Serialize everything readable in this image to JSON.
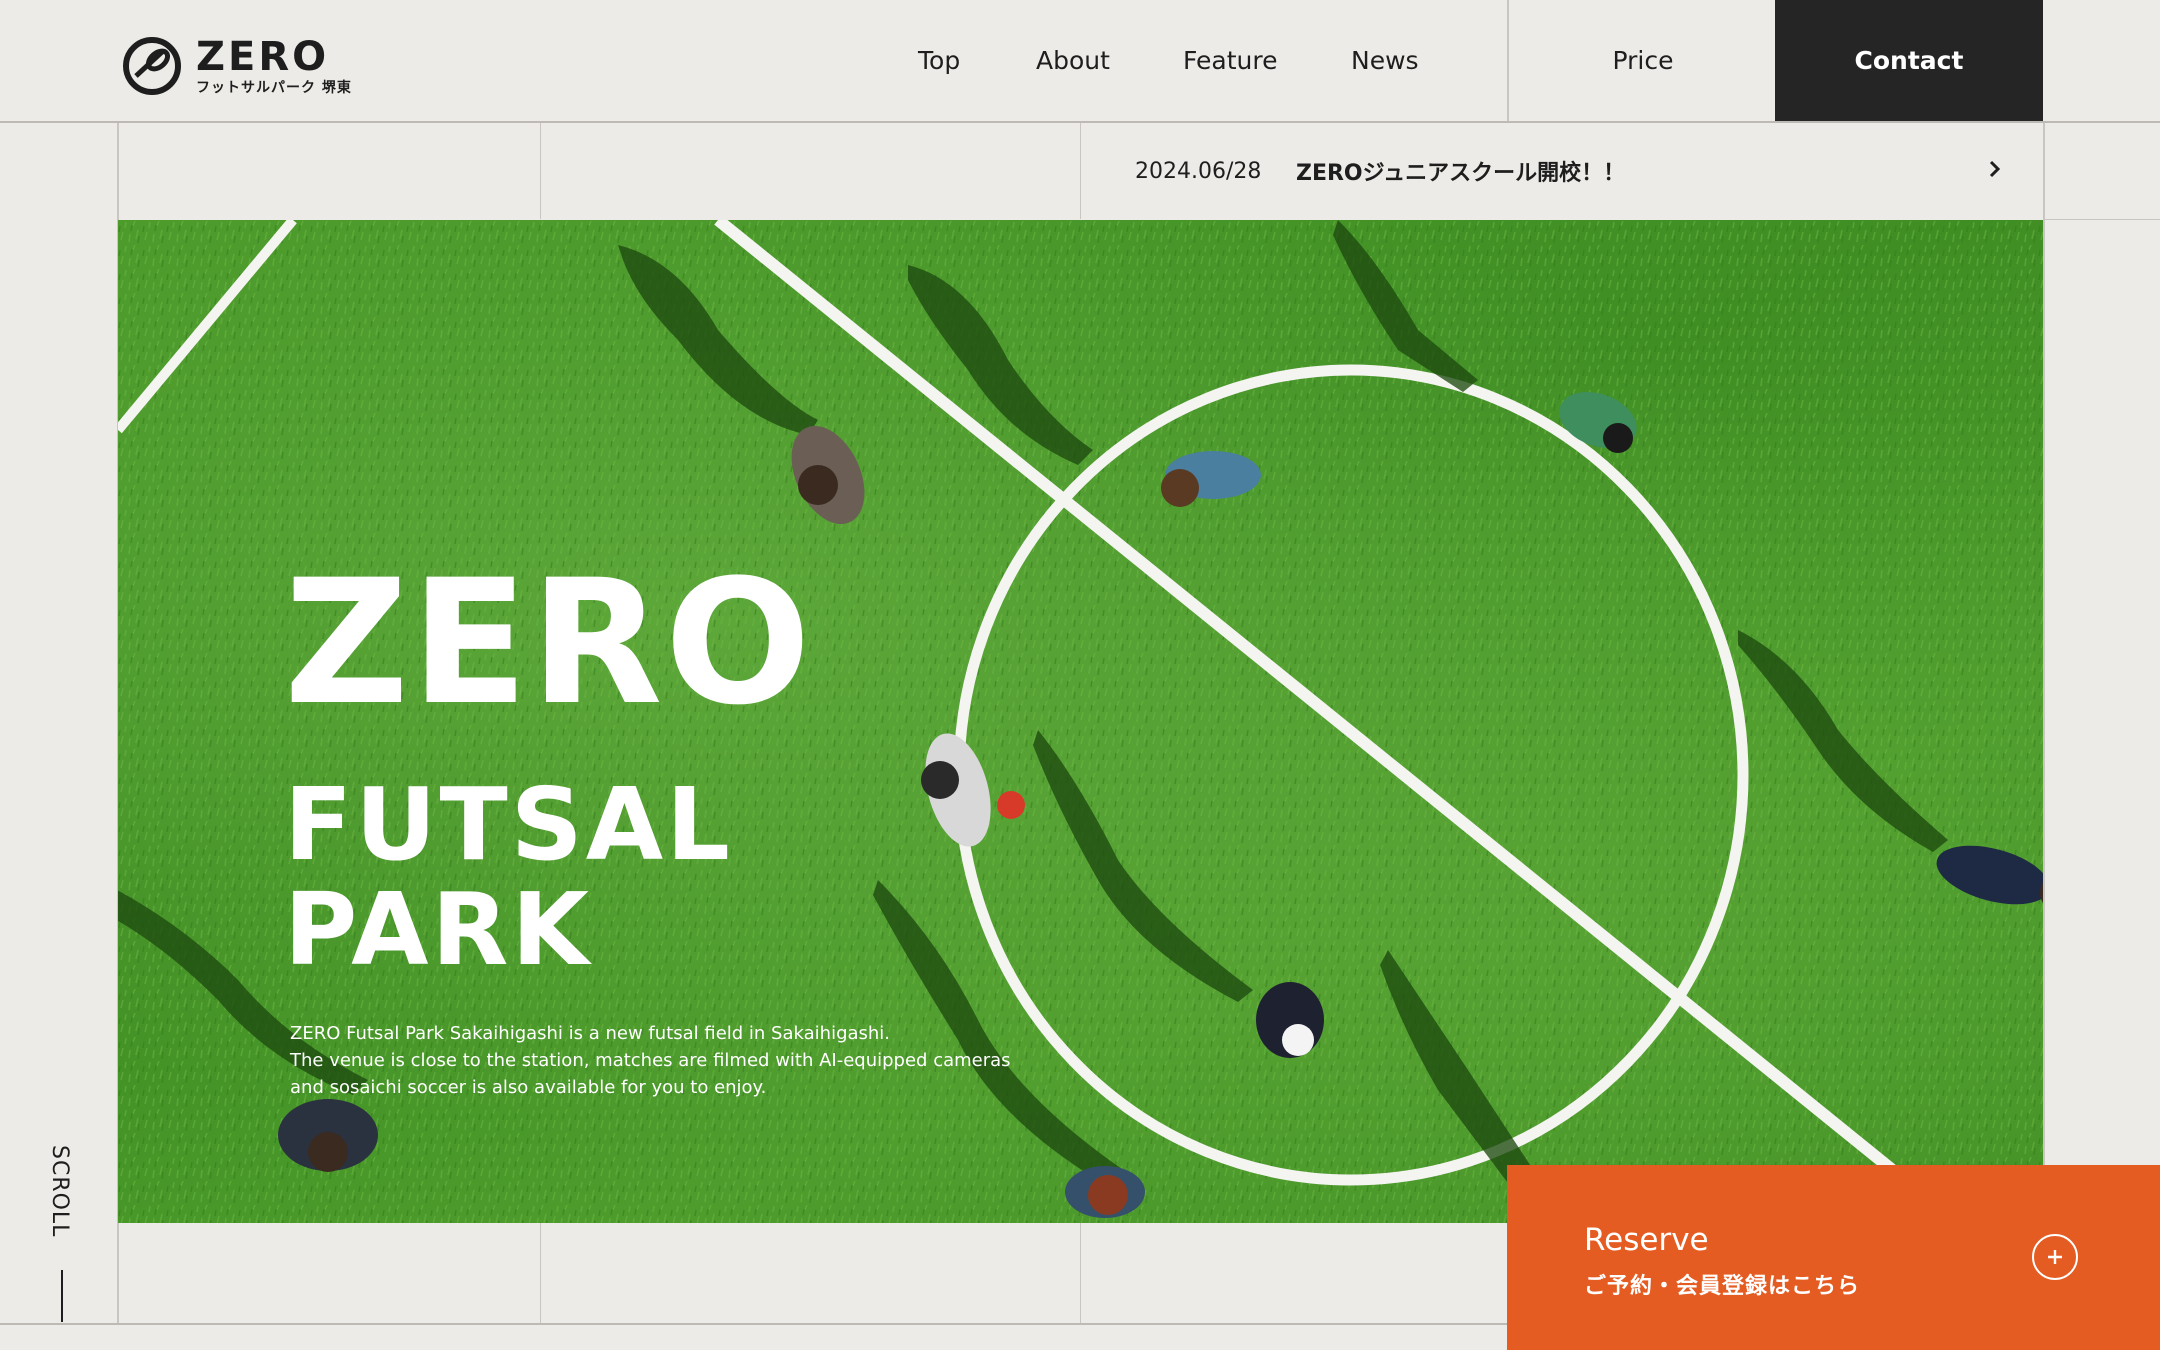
{
  "brand": {
    "wordmark": "ZERO",
    "subtitle": "フットサルパーク 堺東"
  },
  "nav": {
    "top": "Top",
    "about": "About",
    "feature": "Feature",
    "news": "News",
    "price": "Price",
    "contact": "Contact"
  },
  "news": {
    "date": "2024.06/28",
    "title": "ZEROジュニアスクール開校！！"
  },
  "hero": {
    "title_line1": "ZERO",
    "title_line2": "FUTSAL",
    "title_line3": "PARK",
    "description": [
      "ZERO Futsal Park Sakaihigashi is a new futsal field in Sakaihigashi.",
      "The venue is close to the station, matches are filmed with AI-equipped cameras",
      "and sosaichi soccer is also available for you to enjoy."
    ]
  },
  "scroll": {
    "label": "SCROLL"
  },
  "reserve": {
    "title": "Reserve",
    "subtitle": "ご予約・会員登録はこちら"
  },
  "colors": {
    "accent": "#e55c22",
    "dark": "#252525",
    "background": "#edebe8",
    "field": "#4b9a2a"
  },
  "icons": {
    "logo": "soccer-ball-logo-icon",
    "news_arrow": "chevron-right-icon",
    "reserve": "plus-circle-icon"
  }
}
